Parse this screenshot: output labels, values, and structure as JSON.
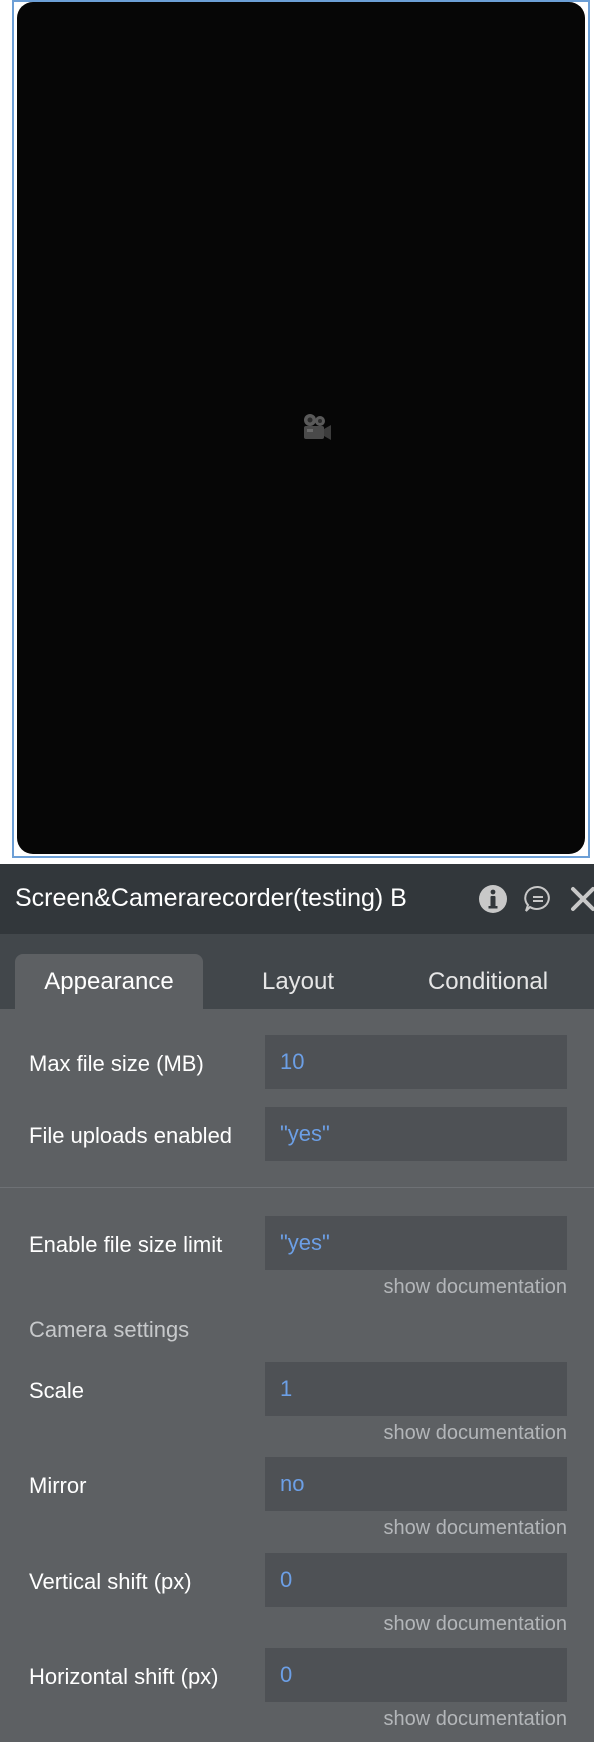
{
  "panel": {
    "title": "Screen&Camerarecorder(testing) B",
    "tabs": [
      {
        "label": "Appearance",
        "active": true
      },
      {
        "label": "Layout",
        "active": false
      },
      {
        "label": "Conditional",
        "active": false
      }
    ],
    "fields": [
      {
        "label": "Max file size (MB)",
        "value": "10"
      },
      {
        "label": "File uploads enabled",
        "value": "\"yes\""
      },
      {
        "label": "Enable file size limit",
        "value": "\"yes\"",
        "doc": "show documentation"
      },
      {
        "label": "Scale",
        "value": "1",
        "doc": "show documentation"
      },
      {
        "label": "Mirror",
        "value": "no",
        "doc": "show documentation"
      },
      {
        "label": "Vertical shift (px)",
        "value": "0",
        "doc": "show documentation"
      },
      {
        "label": "Horizontal shift (px)",
        "value": "0",
        "doc": "show documentation"
      }
    ],
    "section_camera": "Camera settings"
  },
  "icons": {
    "preview": "video-camera-icon",
    "info": "info-icon",
    "comment": "comment-icon",
    "close": "close-icon"
  },
  "colors": {
    "panel_bg": "#5d6063",
    "header_bg": "#32373b",
    "field_bg": "#4e5155",
    "value_text": "#6c9fe6",
    "selection_border": "#6c9fd6"
  }
}
